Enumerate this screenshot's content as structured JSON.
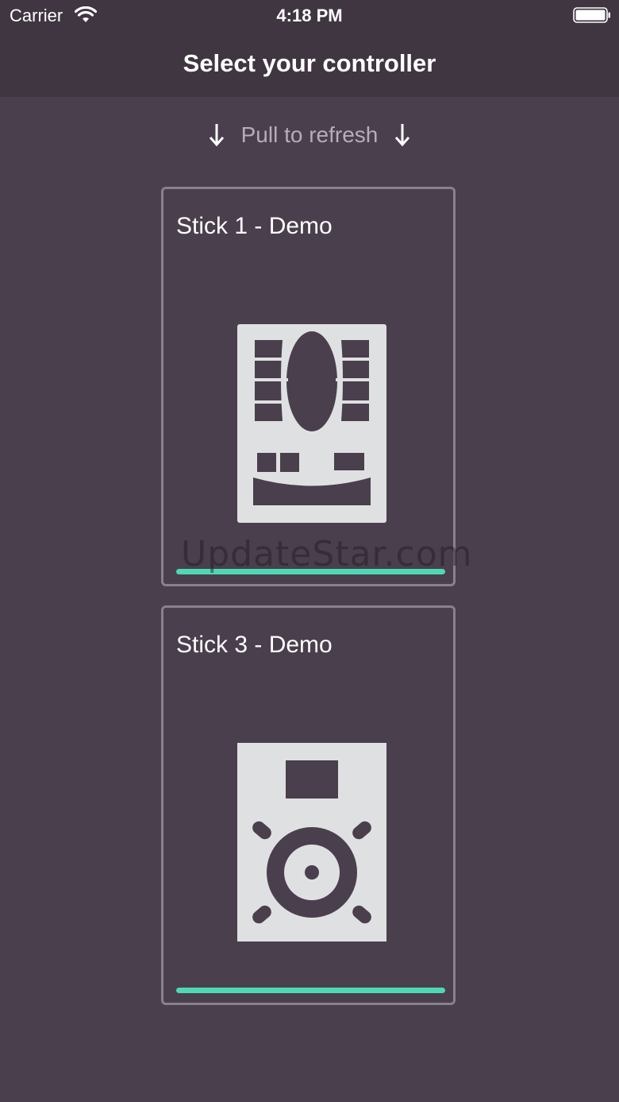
{
  "status_bar": {
    "carrier": "Carrier",
    "time": "4:18 PM",
    "wifi_icon": "wifi-icon",
    "battery_icon": "battery-full-icon"
  },
  "nav": {
    "title": "Select your controller"
  },
  "refresh": {
    "label": "Pull to refresh",
    "icon": "arrow-down-icon"
  },
  "controllers": [
    {
      "name": "Stick 1 - Demo",
      "icon": "controller-deck-icon"
    },
    {
      "name": "Stick 3 - Demo",
      "icon": "speaker-icon"
    }
  ],
  "watermark": "UpdateStar.com",
  "colors": {
    "background": "#4a3f4d",
    "header": "#3f3641",
    "accent": "#4fd8b5",
    "icon_fill": "#dfe0e2"
  }
}
